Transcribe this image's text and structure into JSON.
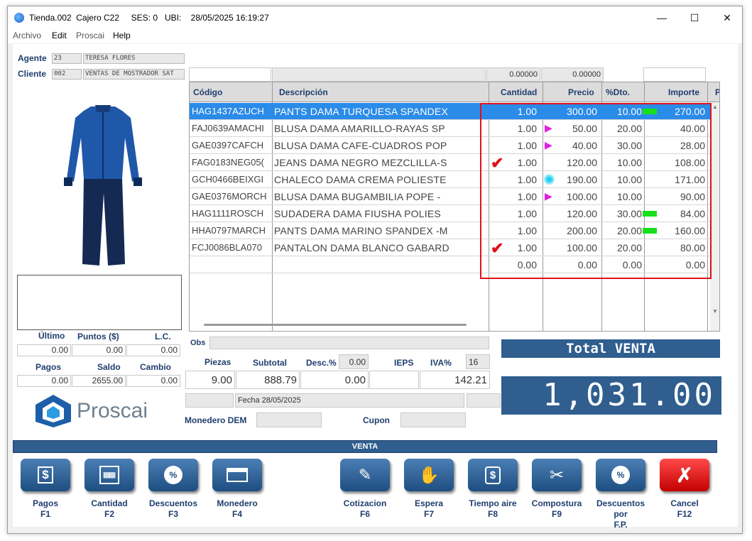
{
  "window": {
    "title": "Tienda.002  Cajero C22     SES: 0   UBI:    28/05/2025 16:19:27",
    "minimize": "—",
    "maximize": "☐",
    "close": "✕"
  },
  "menu": [
    "Archivo",
    "Edit",
    "Proscai",
    "Help"
  ],
  "agente": {
    "label": "Agente",
    "code": "23",
    "name": "TERESA FLORES"
  },
  "cliente": {
    "label": "Cliente",
    "code": "002",
    "name": "VENTAS DE MOSTRADOR SAT"
  },
  "header_values": {
    "v1": "0.00000",
    "v2": "0.00000"
  },
  "columns": [
    "Código",
    "Descripción",
    "Cantidad",
    "Precio",
    "%Dto.",
    "Importe",
    "P"
  ],
  "rows": [
    {
      "code": "HAG1437AZUCH",
      "desc": "PANTS DAMA TURQUESA SPANDEX",
      "qty": "1.00",
      "price": "300.00",
      "dto": "10.00",
      "imp": "270.00",
      "mark": "",
      "flag": "green"
    },
    {
      "code": "FAJ0639AMACHI",
      "desc": "BLUSA DAMA AMARILLO-RAYAS SP",
      "qty": "1.00",
      "price": "50.00",
      "dto": "20.00",
      "imp": "40.00",
      "mark": "triangle",
      "flag": ""
    },
    {
      "code": "GAE0397CAFCH",
      "desc": "BLUSA DAMA CAFE-CUADROS POP",
      "qty": "1.00",
      "price": "40.00",
      "dto": "30.00",
      "imp": "28.00",
      "mark": "triangle",
      "flag": ""
    },
    {
      "code": "FAG0183NEG05(",
      "desc": "JEANS DAMA NEGRO MEZCLILLA-S",
      "qty": "1.00",
      "price": "120.00",
      "dto": "10.00",
      "imp": "108.00",
      "mark": "check",
      "flag": ""
    },
    {
      "code": "GCH0466BEIXGI",
      "desc": "CHALECO DAMA CREMA POLIESTE",
      "qty": "1.00",
      "price": "190.00",
      "dto": "10.00",
      "imp": "171.00",
      "mark": "star",
      "flag": ""
    },
    {
      "code": "GAE0376MORCH",
      "desc": "BLUSA DAMA BUGAMBILIA POPE -",
      "qty": "1.00",
      "price": "100.00",
      "dto": "10.00",
      "imp": "90.00",
      "mark": "triangle",
      "flag": ""
    },
    {
      "code": "HAG1111ROSCH",
      "desc": "SUDADERA DAMA FIUSHA POLIES",
      "qty": "1.00",
      "price": "120.00",
      "dto": "30.00",
      "imp": "84.00",
      "mark": "",
      "flag": "green"
    },
    {
      "code": "HHA0797MARCH",
      "desc": "PANTS DAMA MARINO SPANDEX -M",
      "qty": "1.00",
      "price": "200.00",
      "dto": "20.00",
      "imp": "160.00",
      "mark": "",
      "flag": "green"
    },
    {
      "code": "FCJ0086BLA070",
      "desc": "PANTALON DAMA BLANCO GABARD",
      "qty": "1.00",
      "price": "100.00",
      "dto": "20.00",
      "imp": "80.00",
      "mark": "check",
      "flag": ""
    },
    {
      "code": "",
      "desc": "",
      "qty": "0.00",
      "price": "0.00",
      "dto": "0.00",
      "imp": "0.00",
      "mark": "",
      "flag": ""
    }
  ],
  "left_stats": {
    "ultimo_label": "Último",
    "puntos_label": "Puntos ($)",
    "lc_label": "L.C.",
    "ultimo": "0.00",
    "puntos": "0.00",
    "lc": "0.00",
    "pagos_label": "Pagos",
    "saldo_label": "Saldo",
    "cambio_label": "Cambio",
    "pagos": "0.00",
    "saldo": "2655.00",
    "cambio": "0.00"
  },
  "logo_text": "Proscai",
  "obs_label": "Obs",
  "totals": {
    "piezas_label": "Piezas",
    "subtotal_label": "Subtotal",
    "desc_label": "Desc.%",
    "desc_pct": "0.00",
    "ieps_label": "IEPS",
    "iva_label": "IVA%",
    "iva_pct": "16",
    "piezas": "9.00",
    "subtotal": "888.79",
    "descuento": "0.00",
    "iva": "142.21"
  },
  "fecha": "Fecha 28/05/2025",
  "monedero_label": "Monedero DEM",
  "cupon_label": "Cupon",
  "total_title": "Total VENTA",
  "total_value": "1,031.00",
  "venta_bar": "VENTA",
  "buttons": [
    {
      "label": "Pagos",
      "key": "F1"
    },
    {
      "label": "Cantidad",
      "key": "F2"
    },
    {
      "label": "Descuentos",
      "key": "F3"
    },
    {
      "label": "Monedero",
      "key": "F4"
    },
    {
      "label": "Cotizacion",
      "key": "F6"
    },
    {
      "label": "Espera",
      "key": "F7"
    },
    {
      "label": "Tiempo aire",
      "key": "F8"
    },
    {
      "label": "Compostura",
      "key": "F9"
    },
    {
      "label": "Descuentos por",
      "key": "F.P."
    },
    {
      "label": "Cancel",
      "key": "F12"
    }
  ]
}
